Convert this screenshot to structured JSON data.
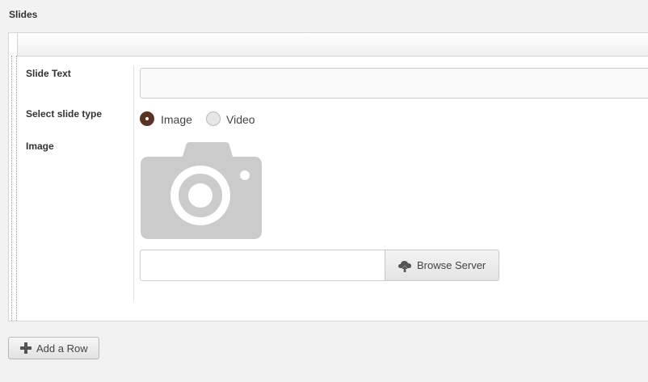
{
  "section": {
    "title": "Slides"
  },
  "fields": {
    "slide_text_label": "Slide Text",
    "slide_text_value": "",
    "slide_type_label": "Select slide type",
    "slide_type_options": [
      "Image",
      "Video"
    ],
    "slide_type_selected": "Image",
    "image_label": "Image",
    "image_path_value": ""
  },
  "buttons": {
    "browse_server": "Browse Server",
    "add_row": "Add a Row"
  },
  "icons": {
    "placeholder": "camera-icon",
    "browse": "cloud-upload-icon",
    "add": "plus-icon"
  },
  "colors": {
    "radio_selected": "#5a3325",
    "camera_placeholder": "#cbcbcb"
  }
}
